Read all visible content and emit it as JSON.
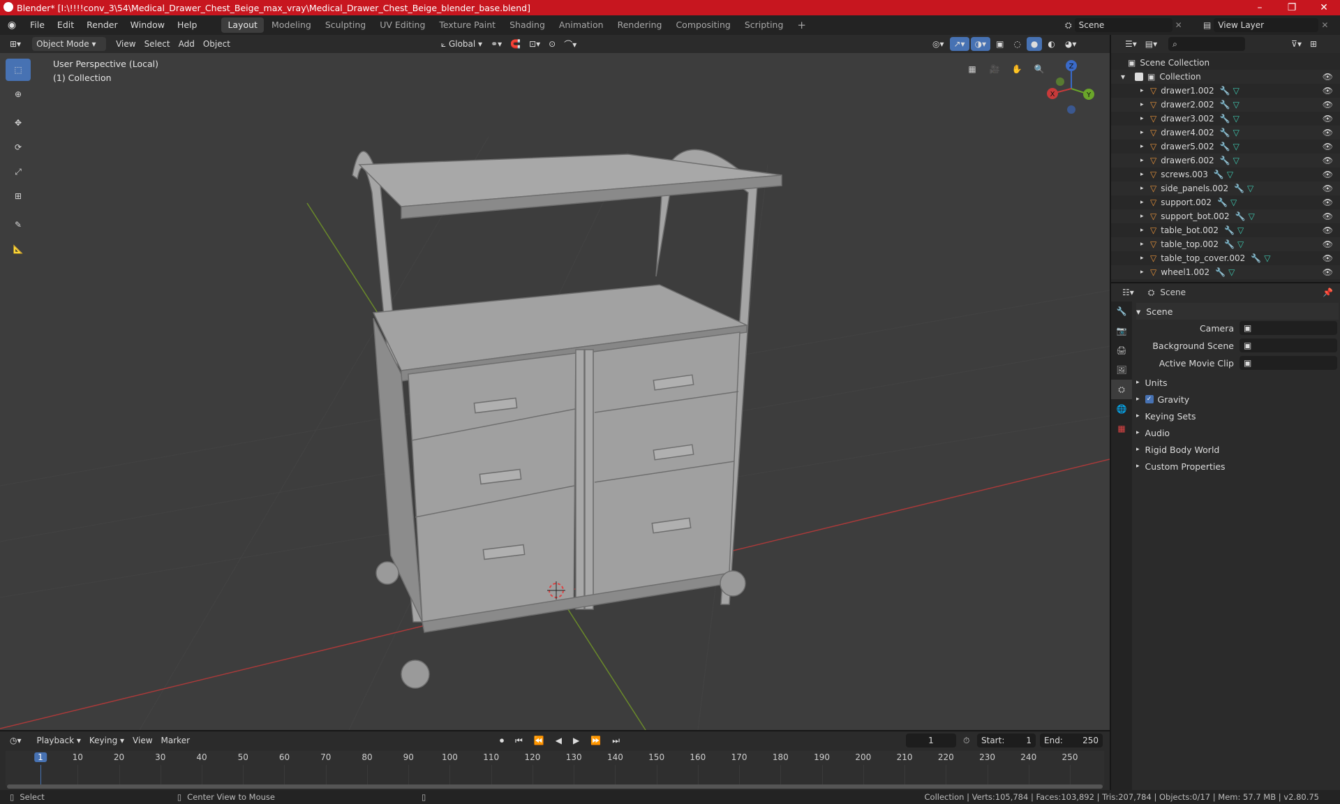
{
  "window": {
    "title": "Blender* [I:\\!!!!conv_3\\54\\Medical_Drawer_Chest_Beige_max_vray\\Medical_Drawer_Chest_Beige_blender_base.blend]",
    "minimize": "–",
    "maximize": "❐",
    "close": "✕"
  },
  "menu": [
    "File",
    "Edit",
    "Render",
    "Window",
    "Help"
  ],
  "workspaces": [
    "Layout",
    "Modeling",
    "Sculpting",
    "UV Editing",
    "Texture Paint",
    "Shading",
    "Animation",
    "Rendering",
    "Compositing",
    "Scripting"
  ],
  "active_workspace": "Layout",
  "add_workspace": "+",
  "scene_field": "Scene",
  "view_layer_field": "View Layer",
  "viewport_header": {
    "mode": "Object Mode",
    "menus": [
      "View",
      "Select",
      "Add",
      "Object"
    ],
    "transform_orientation": "Global"
  },
  "viewport": {
    "perspective_label": "User Perspective (Local)",
    "collection_label": "(1) Collection",
    "gizmo": {
      "x": "X",
      "y": "Y",
      "z": "Z"
    }
  },
  "outliner": {
    "root": "Scene Collection",
    "collection": "Collection",
    "items": [
      {
        "name": "drawer1.002"
      },
      {
        "name": "drawer2.002"
      },
      {
        "name": "drawer3.002"
      },
      {
        "name": "drawer4.002"
      },
      {
        "name": "drawer5.002"
      },
      {
        "name": "drawer6.002"
      },
      {
        "name": "screws.003"
      },
      {
        "name": "side_panels.002"
      },
      {
        "name": "support.002"
      },
      {
        "name": "support_bot.002"
      },
      {
        "name": "table_bot.002"
      },
      {
        "name": "table_top.002"
      },
      {
        "name": "table_top_cover.002"
      },
      {
        "name": "wheel1.002"
      }
    ]
  },
  "properties": {
    "header": "Scene",
    "section": "Scene",
    "fields": [
      {
        "label": "Camera"
      },
      {
        "label": "Background Scene"
      },
      {
        "label": "Active Movie Clip"
      }
    ],
    "panels": [
      "Units",
      "Gravity",
      "Keying Sets",
      "Audio",
      "Rigid Body World",
      "Custom Properties"
    ],
    "gravity_checked": true
  },
  "timeline": {
    "menus": [
      "Playback",
      "Keying",
      "View",
      "Marker"
    ],
    "current_frame": "1",
    "start_label": "Start:",
    "start": "1",
    "end_label": "End:",
    "end": "250",
    "ticks": [
      "1",
      "10",
      "20",
      "30",
      "40",
      "50",
      "60",
      "70",
      "80",
      "90",
      "100",
      "110",
      "120",
      "130",
      "140",
      "150",
      "160",
      "170",
      "180",
      "190",
      "200",
      "210",
      "220",
      "230",
      "240",
      "250"
    ]
  },
  "statusbar": {
    "select": "Select",
    "center_view": "Center View to Mouse",
    "stats": "Collection | Verts:105,784 | Faces:103,892 | Tris:207,784 | Objects:0/17 | Mem: 57.7 MB | v2.80.75"
  },
  "colors": {
    "titlebar": "#c7161f",
    "accent": "#4772b3",
    "object_orange": "#e8933a",
    "modifier_blue": "#7aa3e5",
    "mesh_teal": "#3fc8b0"
  }
}
